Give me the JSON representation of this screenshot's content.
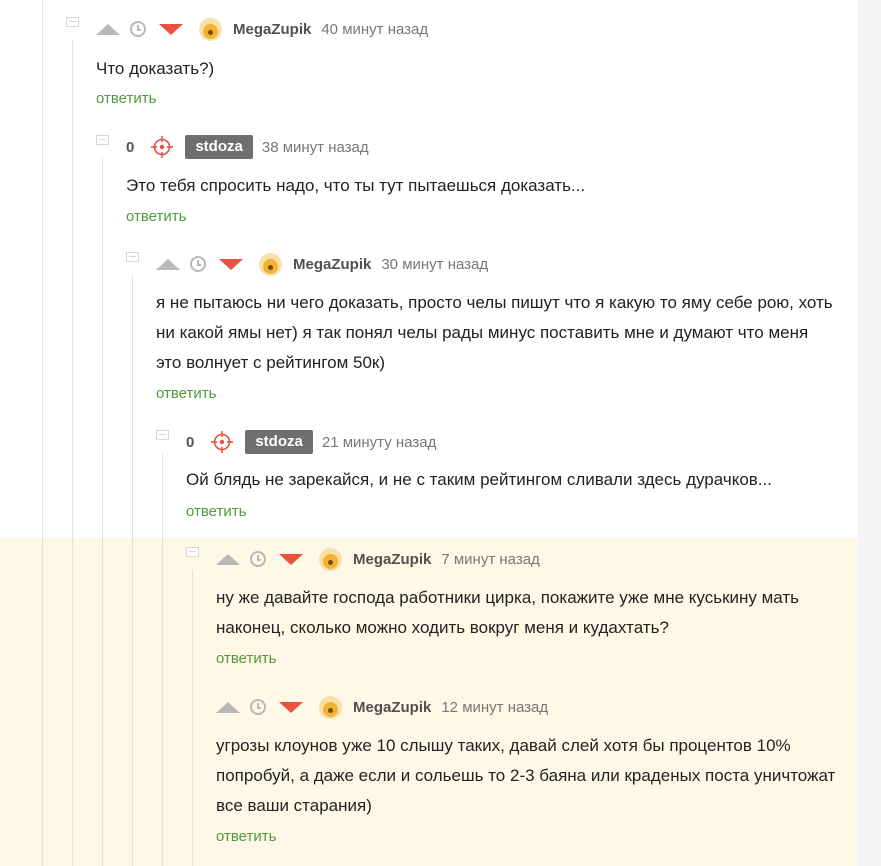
{
  "comments": [
    {
      "author": "MegaZupik",
      "time": "40 минут назад",
      "text": "Что доказать?)",
      "reply": "ответить",
      "has_rating": true
    },
    {
      "author": "stdoza",
      "time": "38 минут назад",
      "score": "0",
      "text": "Это тебя спросить надо, что ты тут пытаешься доказать...",
      "reply": "ответить"
    },
    {
      "author": "MegaZupik",
      "time": "30 минут назад",
      "text": "я не пытаюсь ни чего доказать, просто челы пишут что я какую то яму себе рою, хоть ни какой ямы нет) я так понял челы рады минус поставить мне и думают что меня это волнует с рейтингом 50к)",
      "reply": "ответить"
    },
    {
      "author": "stdoza",
      "time": "21 минуту назад",
      "score": "0",
      "text": "Ой блядь не зарекайся, и не с таким рейтингом сливали здесь дурачков...",
      "reply": "ответить"
    },
    {
      "author": "MegaZupik",
      "time": "7 минут назад",
      "text": "ну же давайте господа работники цирка, покажите уже мне куськину мать наконец, сколько можно ходить вокруг меня и кудахтать?",
      "reply": "ответить"
    },
    {
      "author": "MegaZupik",
      "time": "12 минут назад",
      "text": "угрозы клоунов уже 10 слышу таких, давай слей хотя бы процентов 10% попробуй, а даже если и сольешь то 2-3 баяна или краденых поста уничтожат все ваши старания)",
      "reply": "ответить"
    }
  ],
  "colors": {
    "downvote": "#e8523f",
    "reply_link": "#4e9a3c",
    "new_highlight": "#fff8e6"
  },
  "icons": {
    "upvote": "triangle-up-icon",
    "timer": "clock-icon",
    "downvote": "triangle-down-icon",
    "target": "crosshair-icon"
  }
}
